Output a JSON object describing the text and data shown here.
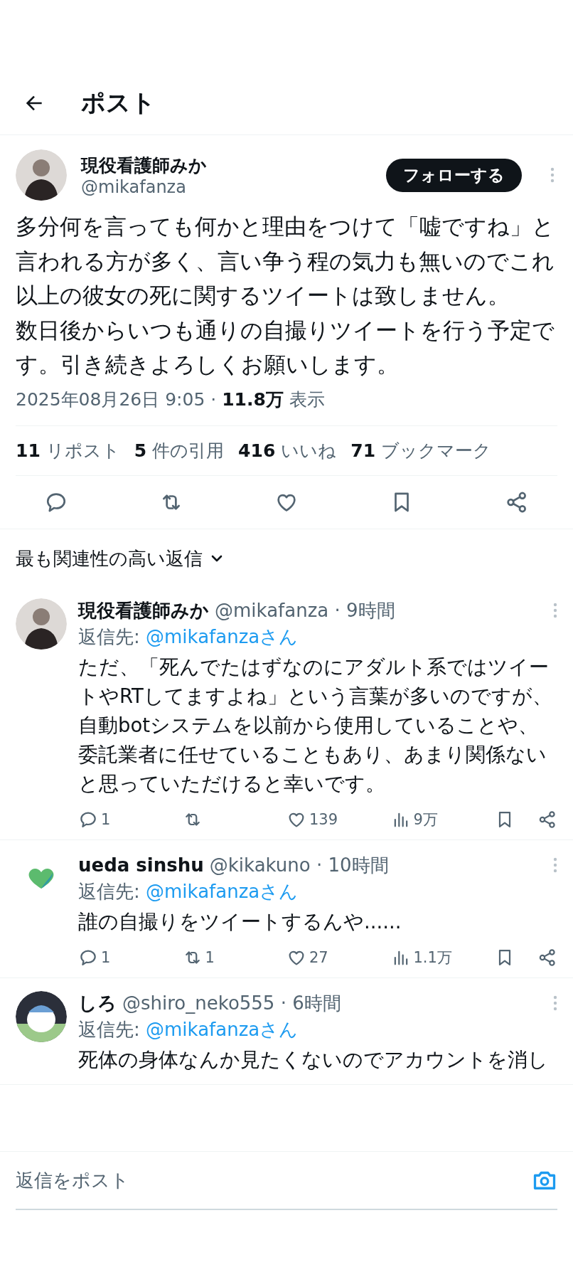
{
  "header": {
    "title": "ポスト"
  },
  "post": {
    "author": {
      "name": "現役看護師みか",
      "handle": "@mikafanza",
      "avatar": {
        "kind": "photo"
      }
    },
    "follow_button": "フォローする",
    "paragraphs": [
      "多分何を言っても何かと理由をつけて「嘘ですね」と言われる方が多く、言い争う程の気力も無いのでこれ以上の彼女の死に関するツイートは致しません。",
      "数日後からいつも通りの自撮りツイートを行う予定です。引き続きよろしくお願いします。"
    ],
    "meta": "2025年08月26日 9:05 · **11.8万** 表示",
    "stats": [
      "**11** リポスト",
      "**5** 件の引用",
      "**416** いいね",
      "**71** ブックマーク"
    ],
    "actions": [
      {
        "kind": "reply"
      },
      {
        "kind": "repost"
      },
      {
        "kind": "like"
      },
      {
        "kind": "bookmark"
      },
      {
        "kind": "share"
      }
    ]
  },
  "replies_sort": {
    "label": "最も関連性の高い返信"
  },
  "replies": [
    {
      "name": "現役看護師みか",
      "meta": "@mikafanza · 9時間",
      "avatar": {
        "kind": "photo"
      },
      "reply_to": {
        "label": "返信先:",
        "target": "@mikafanzaさん"
      },
      "text": "ただ、「死んでたはずなのにアダルト系ではツイートやRTしてますよね」という言葉が多いのですが、自動botシステムを以前から使用していることや、委託業者に任せていることもあり、あまり関係ないと思っていただけると幸いです。",
      "actions": [
        {
          "kind": "reply",
          "count": "1"
        },
        {
          "kind": "repost"
        },
        {
          "kind": "like",
          "count": "139"
        },
        {
          "kind": "views",
          "count": "9万"
        },
        {
          "kind": "bookmark"
        },
        {
          "kind": "share"
        }
      ]
    },
    {
      "name": "ueda sinshu",
      "meta": "@kikakuno · 10時間",
      "avatar": {
        "kind": "logo"
      },
      "reply_to": {
        "label": "返信先:",
        "target": "@mikafanzaさん"
      },
      "text": "誰の自撮りをツイートするんや......",
      "actions": [
        {
          "kind": "reply",
          "count": "1"
        },
        {
          "kind": "repost",
          "count": "1"
        },
        {
          "kind": "like",
          "count": "27"
        },
        {
          "kind": "views",
          "count": "1.1万"
        },
        {
          "kind": "bookmark"
        },
        {
          "kind": "share"
        }
      ]
    },
    {
      "name": "しろ",
      "meta": "@shiro_neko555 · 6時間",
      "avatar": {
        "kind": "illustration"
      },
      "reply_to": {
        "label": "返信先:",
        "target": "@mikafanzaさん"
      },
      "text": "死体の身体なんか見たくないのでアカウントを消し"
    }
  ],
  "reply_bar": {
    "placeholder": "返信をポスト"
  }
}
